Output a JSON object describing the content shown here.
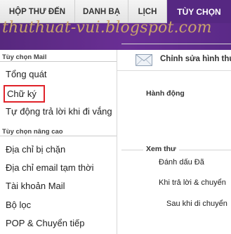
{
  "top_tabs": {
    "inbox": "HỘP THƯ ĐẾN",
    "contacts": "DANH BẠ",
    "calendar": "LỊCH",
    "options": "TÙY CHỌN"
  },
  "watermark": "thuthuat-vui.blogspot.com",
  "sidebar": {
    "mail_section": "Tùy chọn Mail",
    "mail_items": [
      "Tổng quát",
      "Chữ ký",
      "Tự động trả lời khi đi vắng"
    ],
    "advanced_section": "Tùy chọn nâng cao",
    "advanced_items": [
      "Địa chỉ bị chặn",
      "Địa chỉ email tạm thời",
      "Tài khoản Mail",
      "Bộ lọc",
      "POP & Chuyển tiếp"
    ]
  },
  "content": {
    "title": "Chỉnh sửa hình thư",
    "group_action": "Hành động",
    "group_view": "Xem thư",
    "settings": [
      "Đánh dấu Đã",
      "Khi trả lời & chuyển",
      "Sau khi di chuyển"
    ]
  },
  "colors": {
    "accent_purple": "#562882",
    "highlight_red": "#e0232a",
    "watermark": "#c9a36b"
  },
  "icons": {
    "envelope": "envelope-icon"
  }
}
